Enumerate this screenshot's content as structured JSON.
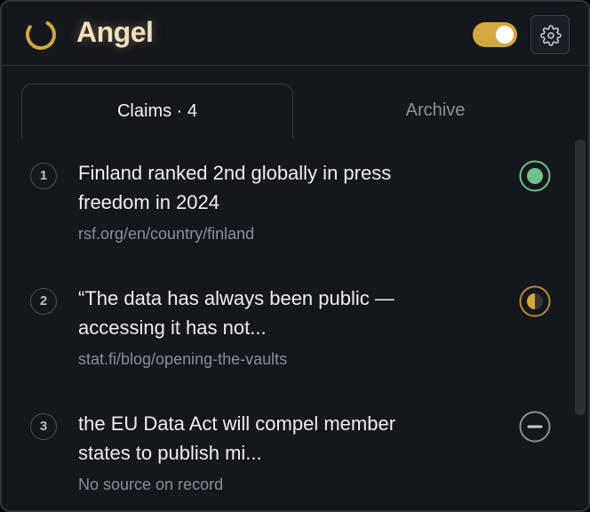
{
  "app": {
    "title": "Angel",
    "logo_icon": "loading-ring-icon",
    "accent": "#d4a63e",
    "toggle_on": true
  },
  "header": {
    "settings_icon": "gear-icon"
  },
  "tabs": [
    {
      "label": "Claims · 4",
      "active": true
    },
    {
      "label": "Archive",
      "active": false
    }
  ],
  "claims": [
    {
      "number": "1",
      "text_line1": "Finland ranked 2nd globally in press",
      "text_line2": "freedom in 2024",
      "source": "rsf.org/en/country/finland",
      "status": "verified",
      "status_icon": "verified-dot-icon",
      "status_color": "#6fc28a"
    },
    {
      "number": "2",
      "text_line1": "“The data has always been public —",
      "text_line2": "accessing it has not...",
      "source": "stat.fi/blog/opening-the-vaults",
      "status": "partial",
      "status_icon": "half-circle-icon",
      "status_color": "#d4a63e"
    },
    {
      "number": "3",
      "text_line1": "the EU Data Act will compel member",
      "text_line2": "states to publish mi...",
      "source": "No source on record",
      "status": "unsourced",
      "status_icon": "minus-circle-icon",
      "status_color": "#c8ccd2"
    }
  ]
}
